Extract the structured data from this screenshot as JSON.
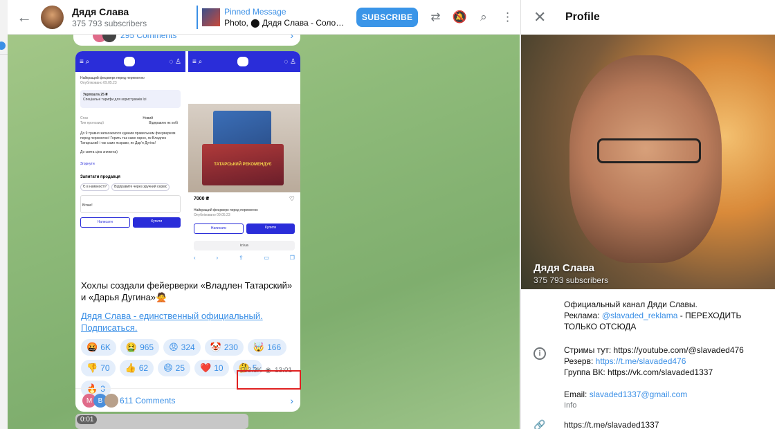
{
  "header": {
    "channel_title": "Дядя Слава",
    "channel_subtitle": "375 793 subscribers",
    "pinned_title": "Pinned Message",
    "pinned_text": "Photo, ⬤ Дядя Слава - Соло…",
    "subscribe_label": "SUBSCRIBE",
    "icons": [
      "back-arrow-icon",
      "video-chat-icon",
      "mute-icon",
      "search-icon",
      "more-icon"
    ]
  },
  "message": {
    "prev_comments": "295 Comments",
    "title": "Хохлы создали фейерверки «Владлен Татарский» и «Дарья Дугина»🙅",
    "link": "Дядя Слава - единственный официальный. Подписаться.",
    "reactions": [
      {
        "emoji": "🤬",
        "count": "6K"
      },
      {
        "emoji": "🤮",
        "count": "965"
      },
      {
        "emoji": "😡",
        "count": "324"
      },
      {
        "emoji": "🤡",
        "count": "230"
      },
      {
        "emoji": "🤯",
        "count": "166"
      },
      {
        "emoji": "👎",
        "count": "70"
      },
      {
        "emoji": "👍",
        "count": "62"
      },
      {
        "emoji": "😄",
        "count": "25"
      },
      {
        "emoji": "❤️",
        "count": "10"
      },
      {
        "emoji": "🤔",
        "count": "5"
      },
      {
        "emoji": "🔥",
        "count": "3"
      }
    ],
    "views": "163.3K",
    "time": "13:01",
    "comments": "611 Comments",
    "comment_avatars": [
      "M",
      "B",
      ""
    ]
  },
  "shot_left": {
    "heading": "Найкращий феєрверк перед перемогою",
    "date": "Опубліковано 09.05.23",
    "promo": "Укрпошта 25 ₴",
    "promo_sub": "Спеціальні тарифи для користувачів Izi",
    "cond_label": "Стан",
    "cond_val": "Новий",
    "type_label": "Тип пропозиції",
    "type_val": "Відправлю як хобі",
    "body": "До 9 травня запасаємося єдиним правильним феєрверком перед перемогою! Горить так само гарно, як Владлен Татарський і так само яскраво, як Дарʼя Дугіна!",
    "price_note": "До свята ціна знижена)",
    "more": "Згорнути",
    "ask": "Запитати продавця",
    "chip1": "Є в наявності?",
    "chip2": "Відправите через зручний сервіс",
    "input": "Вітаю!",
    "write": "Написати",
    "buy": "Купити"
  },
  "shot_right": {
    "price": "7000 ₴",
    "heading": "Найкращий феєрверк перед перемогою",
    "date": "Опубліковано 09.05.23",
    "write": "Написати",
    "buy": "Купити",
    "url": "izi.ua",
    "box_text": "ТАТАРСЬКИЙ РЕКОМЕНДУЄ"
  },
  "next": {
    "timer": "0:01"
  },
  "profile": {
    "title": "Profile",
    "name": "Дядя Слава",
    "subscribers": "375 793 subscribers",
    "desc_line1": "Официальный канал Дяди Славы.",
    "desc_line2a": "Реклама: ",
    "desc_line2b": "@slavaded_reklama",
    "desc_line2c": " - ПЕРЕХОДИТЬ ТОЛЬКО ОТСЮДА",
    "streams": "Стримы тут: https://youtube.com/@slavaded476",
    "reserve_label": "Резерв: ",
    "reserve_link": "https://t.me/slavaded476",
    "vk": "Группа ВК: https://vk.com/slavaded1337",
    "email_label": "Email: ",
    "email": "slavaded1337@gmail.com",
    "info_label": "Info",
    "link": "https://t.me/slavaded1337"
  }
}
